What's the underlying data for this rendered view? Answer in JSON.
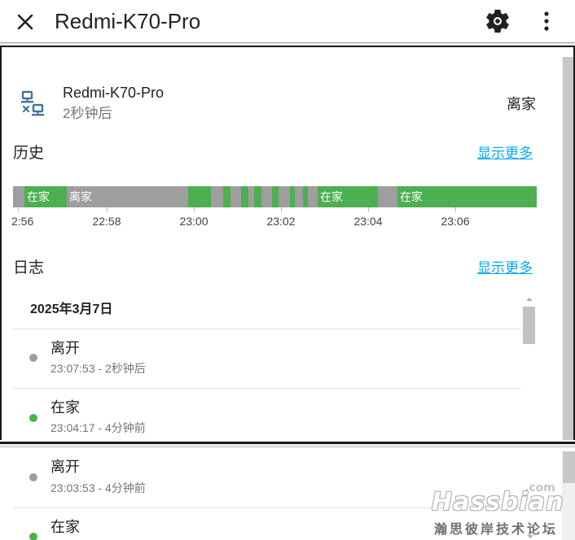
{
  "header": {
    "title": "Redmi-K70-Pro",
    "close_icon": "close-icon",
    "settings_icon": "gear-icon",
    "more_icon": "more-vertical-icon"
  },
  "entity": {
    "icon": "lan-disconnect-icon",
    "name": "Redmi-K70-Pro",
    "relative_time": "2秒钟后",
    "state": "离家"
  },
  "history": {
    "title": "历史",
    "show_more": "显示更多",
    "segments": [
      {
        "state": "away",
        "label": ""
      },
      {
        "state": "home",
        "label": "在家"
      },
      {
        "state": "away",
        "label": "离家"
      },
      {
        "state": "home",
        "label": ""
      },
      {
        "state": "away",
        "label": ""
      },
      {
        "state": "home",
        "label": ""
      },
      {
        "state": "away",
        "label": ""
      },
      {
        "state": "home",
        "label": ""
      },
      {
        "state": "away",
        "label": ""
      },
      {
        "state": "home",
        "label": ""
      },
      {
        "state": "away",
        "label": ""
      },
      {
        "state": "home",
        "label": ""
      },
      {
        "state": "away",
        "label": ""
      },
      {
        "state": "home",
        "label": ""
      },
      {
        "state": "away",
        "label": ""
      },
      {
        "state": "home",
        "label": ""
      },
      {
        "state": "away",
        "label": ""
      },
      {
        "state": "home",
        "label": "在家"
      },
      {
        "state": "away",
        "label": ""
      },
      {
        "state": "home",
        "label": "在家"
      }
    ],
    "ticks": [
      "2:56",
      "22:58",
      "23:00",
      "23:02",
      "23:04",
      "23:06"
    ],
    "colors": {
      "home": "#4caf50",
      "away": "#9e9e9e"
    }
  },
  "logbook": {
    "title": "日志",
    "show_more": "显示更多",
    "date": "2025年3月7日",
    "entries": [
      {
        "state": "离开",
        "time": "23:07:53 - 2秒钟后",
        "dot_color": "#9e9e9e"
      },
      {
        "state": "在家",
        "time": "23:04:17 - 4分钟前",
        "dot_color": "#4caf50"
      },
      {
        "state": "离开",
        "time": "23:03:53 - 4分钟前",
        "dot_color": "#9e9e9e"
      },
      {
        "state": "在家",
        "time": "",
        "dot_color": "#4caf50"
      }
    ]
  },
  "watermark": {
    "com": ".com",
    "brand": "Hassbian",
    "subtitle": "瀚思彼岸技术论坛"
  },
  "colors": {
    "accent_link": "#03a9f4",
    "home": "#4caf50",
    "away": "#9e9e9e"
  }
}
